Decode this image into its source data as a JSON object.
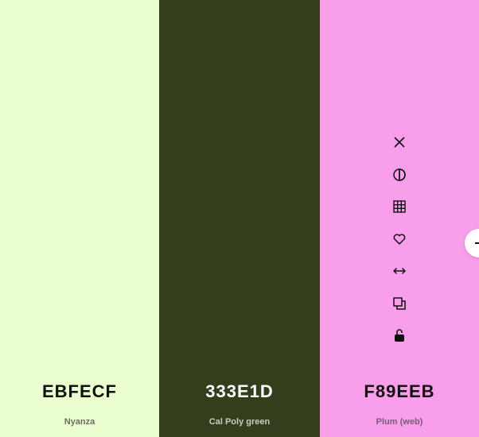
{
  "colors": [
    {
      "hex": "EBFECF",
      "name": "Nyanza",
      "background": "#EBFECF",
      "text_color": "#111111",
      "name_color": "#6b6f63"
    },
    {
      "hex": "333E1D",
      "name": "Cal Poly green",
      "background": "#333E1D",
      "text_color": "#FFFFFF",
      "name_color": "#c9ccc2"
    },
    {
      "hex": "F89EEB",
      "name": "Plum (web)",
      "background": "#F89EEB",
      "text_color": "#111111",
      "name_color": "#7a5e74"
    }
  ],
  "toolbar_icons": [
    "close-icon",
    "contrast-icon",
    "grid-icon",
    "heart-icon",
    "drag-icon",
    "copy-icon",
    "lock-icon"
  ]
}
